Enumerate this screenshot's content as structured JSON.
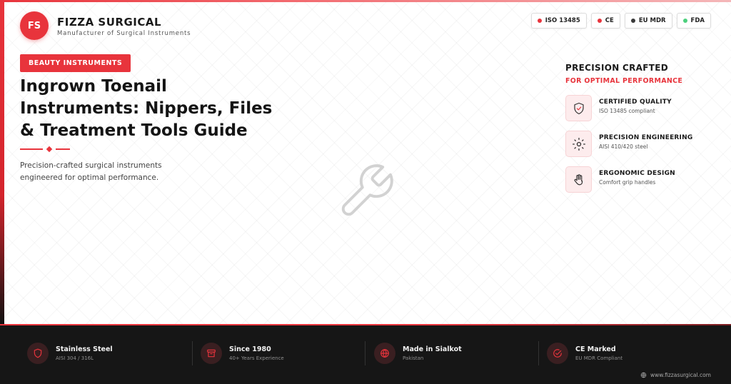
{
  "brand": {
    "logo_text": "FS",
    "name": "FIZZA SURGICAL",
    "tagline": "Manufacturer of Surgical Instruments"
  },
  "certifications": [
    {
      "label": "ISO 13485",
      "color": "#e8343c"
    },
    {
      "label": "CE",
      "color": "#e8343c"
    },
    {
      "label": "EU MDR",
      "color": "#3a3a3a"
    },
    {
      "label": "FDA",
      "color": "#4cd07d"
    }
  ],
  "hero": {
    "category_badge": "BEAUTY INSTRUMENTS",
    "title": "Ingrown Toenail Instruments: Nippers, Files & Treatment Tools Guide",
    "description": "Precision-crafted surgical instruments engineered for optimal performance.",
    "center_icon": "wrench-icon"
  },
  "features_panel": {
    "title": "PRECISION CRAFTED",
    "subtitle": "FOR OPTIMAL PERFORMANCE",
    "items": [
      {
        "icon": "shield-check-icon",
        "title": "CERTIFIED QUALITY",
        "subtitle": "ISO 13485 compliant"
      },
      {
        "icon": "gear-icon",
        "title": "PRECISION ENGINEERING",
        "subtitle": "AISI 410/420 steel"
      },
      {
        "icon": "hand-icon",
        "title": "ERGONOMIC DESIGN",
        "subtitle": "Comfort grip handles"
      }
    ]
  },
  "footer": {
    "items": [
      {
        "icon": "shield-icon",
        "title": "Stainless Steel",
        "subtitle": "AISI 304 / 316L"
      },
      {
        "icon": "factory-icon",
        "title": "Since 1980",
        "subtitle": "40+ Years Experience"
      },
      {
        "icon": "globe-icon",
        "title": "Made in Sialkot",
        "subtitle": "Pakistan"
      },
      {
        "icon": "check-circle-icon",
        "title": "CE Marked",
        "subtitle": "EU MDR Compliant"
      }
    ],
    "website": "www.fizzasurgical.com"
  },
  "colors": {
    "accent": "#e8343c",
    "footer_bg": "#161616"
  }
}
